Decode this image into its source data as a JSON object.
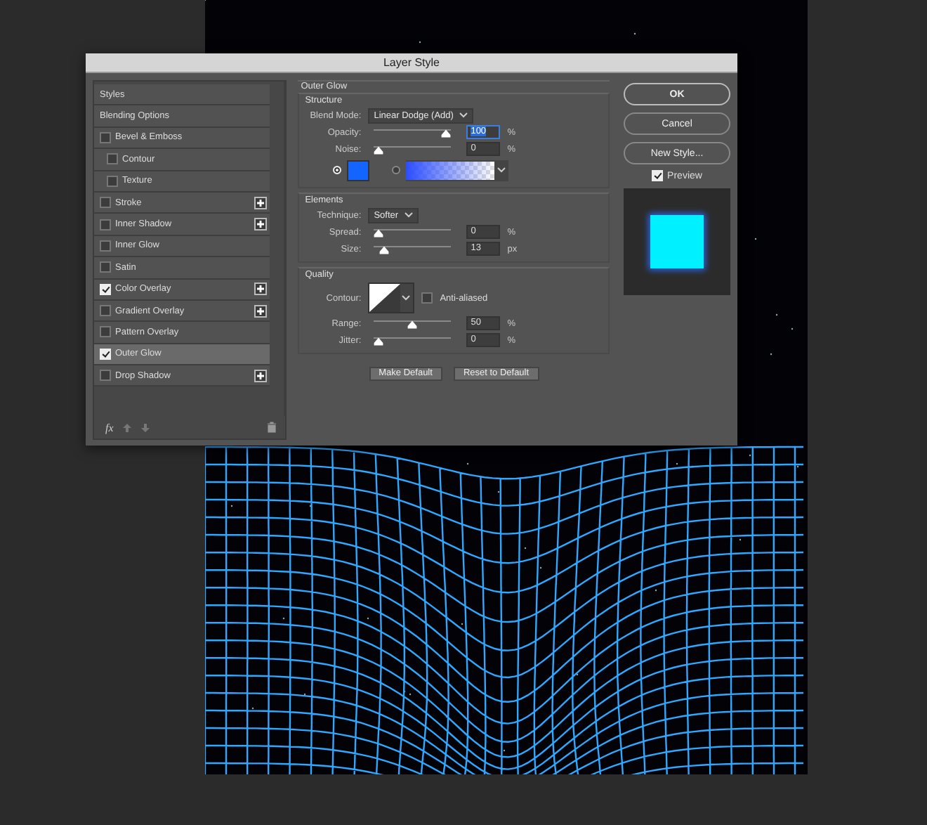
{
  "window": {
    "title": "Layer Style"
  },
  "styles_list": {
    "items": [
      {
        "label": "Styles",
        "kind": "header",
        "selected": false
      },
      {
        "label": "Blending Options",
        "kind": "header",
        "selected": false
      },
      {
        "label": "Bevel & Emboss",
        "kind": "check",
        "checked": false,
        "selected": false,
        "addable": false
      },
      {
        "label": "Contour",
        "kind": "subcheck",
        "checked": false,
        "selected": false,
        "addable": false
      },
      {
        "label": "Texture",
        "kind": "subcheck",
        "checked": false,
        "selected": false,
        "addable": false
      },
      {
        "label": "Stroke",
        "kind": "check",
        "checked": false,
        "selected": false,
        "addable": true
      },
      {
        "label": "Inner Shadow",
        "kind": "check",
        "checked": false,
        "selected": false,
        "addable": true
      },
      {
        "label": "Inner Glow",
        "kind": "check",
        "checked": false,
        "selected": false,
        "addable": false
      },
      {
        "label": "Satin",
        "kind": "check",
        "checked": false,
        "selected": false,
        "addable": false
      },
      {
        "label": "Color Overlay",
        "kind": "check",
        "checked": true,
        "selected": false,
        "addable": true
      },
      {
        "label": "Gradient Overlay",
        "kind": "check",
        "checked": false,
        "selected": false,
        "addable": true
      },
      {
        "label": "Pattern Overlay",
        "kind": "check",
        "checked": false,
        "selected": false,
        "addable": false
      },
      {
        "label": "Outer Glow",
        "kind": "check",
        "checked": true,
        "selected": true,
        "addable": false
      },
      {
        "label": "Drop Shadow",
        "kind": "check",
        "checked": false,
        "selected": false,
        "addable": true
      }
    ],
    "fx_label": "fx"
  },
  "outer_glow": {
    "title": "Outer Glow",
    "structure": {
      "title": "Structure",
      "blend_mode": {
        "label": "Blend Mode:",
        "value": "Linear Dodge (Add)"
      },
      "opacity": {
        "label": "Opacity:",
        "level": 1,
        "value": "100",
        "unit": "%",
        "focused": true
      },
      "noise": {
        "label": "Noise:",
        "level": 0,
        "value": "0",
        "unit": "%",
        "focused": false
      },
      "fill_options": [
        {
          "kind": "color",
          "selected": true,
          "color": "#1464ff"
        },
        {
          "kind": "gradient",
          "selected": false
        }
      ]
    },
    "elements": {
      "title": "Elements",
      "technique": {
        "label": "Technique:",
        "value": "Softer"
      },
      "spread": {
        "label": "Spread:",
        "level": 0,
        "value": "0",
        "unit": "%",
        "focused": false
      },
      "size": {
        "label": "Size:",
        "level": 0.07,
        "value": "13",
        "unit": "px",
        "focused": false
      }
    },
    "quality": {
      "title": "Quality",
      "contour_label": "Contour:",
      "anti_aliased": {
        "label": "Anti-aliased",
        "checked": false
      },
      "range": {
        "label": "Range:",
        "level": 0.5,
        "value": "50",
        "unit": "%",
        "focused": false
      },
      "jitter": {
        "label": "Jitter:",
        "level": 0,
        "value": "0",
        "unit": "%",
        "focused": false
      }
    },
    "buttons": [
      "Make Default",
      "Reset to Default"
    ]
  },
  "actions": [
    {
      "label": "OK",
      "default": true
    },
    {
      "label": "Cancel",
      "default": false
    },
    {
      "label": "New Style...",
      "default": false
    }
  ],
  "preview": {
    "label": "Preview",
    "checked": true
  }
}
